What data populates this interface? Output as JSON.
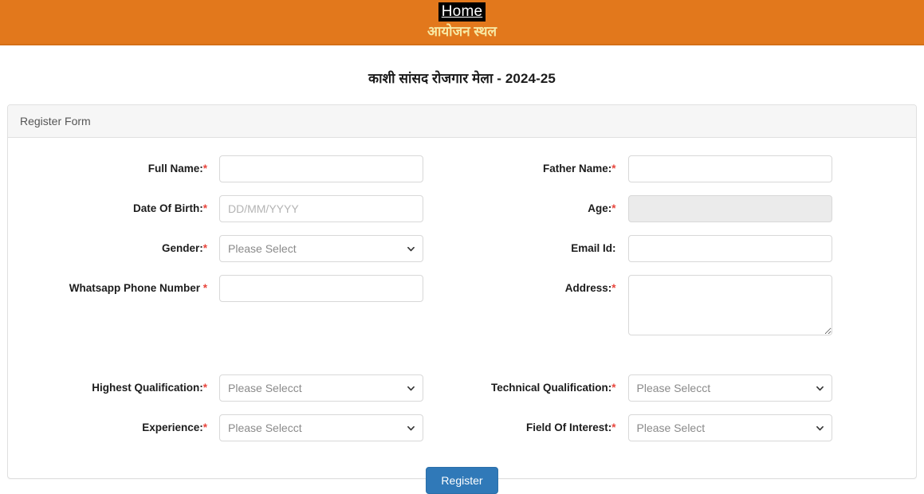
{
  "topbar": {
    "home_label": "Home",
    "subtitle": "आयोजन स्थल",
    "bg_color": "#e2781c",
    "subtitle_color": "#f7e9a4"
  },
  "page_title": "काशी सांसद रोजगार मेला - 2024-25",
  "panel": {
    "heading": "Register Form"
  },
  "form": {
    "rows": [
      {
        "left": {
          "label": "Full Name:",
          "required": true,
          "type": "text",
          "value": "",
          "placeholder": ""
        },
        "right": {
          "label": "Father Name:",
          "required": true,
          "type": "text",
          "value": "",
          "placeholder": ""
        }
      },
      {
        "left": {
          "label": "Date Of Birth:",
          "required": true,
          "type": "text",
          "value": "",
          "placeholder": "DD/MM/YYYY"
        },
        "right": {
          "label": "Age:",
          "required": true,
          "type": "text",
          "value": "",
          "placeholder": "",
          "disabled": true
        }
      },
      {
        "left": {
          "label": "Gender:",
          "required": true,
          "type": "select",
          "value": "Please Select"
        },
        "right": {
          "label": "Email Id:",
          "required": false,
          "type": "text",
          "value": "",
          "placeholder": ""
        }
      },
      {
        "left": {
          "label": "Whatsapp Phone Number",
          "required": true,
          "spaced_star": true,
          "type": "text",
          "value": "",
          "placeholder": ""
        },
        "right": {
          "label": "Address:",
          "required": true,
          "type": "textarea",
          "value": "",
          "placeholder": ""
        }
      },
      {
        "left": {
          "label": "Highest Qualification:",
          "required": true,
          "type": "select",
          "value": "Please Selecct"
        },
        "right": {
          "label": "Technical Qualification:",
          "required": true,
          "type": "select",
          "value": "Please Selecct"
        }
      },
      {
        "left": {
          "label": "Experience:",
          "required": true,
          "type": "select",
          "value": "Please Selecct"
        },
        "right": {
          "label": "Field Of Interest:",
          "required": true,
          "type": "select",
          "value": "Please Select"
        }
      }
    ],
    "submit_label": "Register",
    "submit_color": "#3079b8"
  }
}
